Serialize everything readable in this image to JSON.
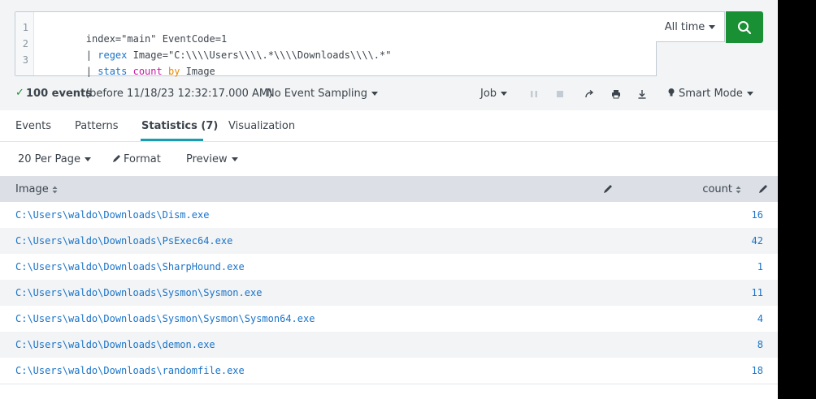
{
  "search": {
    "lines": [
      {
        "num": "1",
        "parts": [
          {
            "t": "index=\"main\" EventCode=1",
            "c": ""
          }
        ]
      },
      {
        "num": "2",
        "parts": [
          {
            "t": "| ",
            "c": ""
          },
          {
            "t": "regex",
            "c": "cmd"
          },
          {
            "t": " Image=\"C:\\\\\\\\Users\\\\\\\\.*\\\\\\\\Downloads\\\\\\\\.*\"",
            "c": ""
          }
        ]
      },
      {
        "num": "3",
        "parts": [
          {
            "t": "| ",
            "c": ""
          },
          {
            "t": "stats",
            "c": "cmd"
          },
          {
            "t": " ",
            "c": ""
          },
          {
            "t": "count",
            "c": "fn"
          },
          {
            "t": " ",
            "c": ""
          },
          {
            "t": "by",
            "c": "by"
          },
          {
            "t": " Image",
            "c": ""
          }
        ]
      }
    ],
    "time_range": "All time",
    "search_icon": "search-icon"
  },
  "status": {
    "check_icon": "✓",
    "events_count": "100 events",
    "events_before": "(before 11/18/23 12:32:17.000 AM)",
    "sampling": "No Event Sampling",
    "job": "Job",
    "mode": "Smart Mode"
  },
  "tabs": [
    {
      "label": "Events",
      "active": false
    },
    {
      "label": "Patterns",
      "active": false
    },
    {
      "label": "Statistics (7)",
      "active": true
    },
    {
      "label": "Visualization",
      "active": false
    }
  ],
  "toolbar": {
    "per_page": "20 Per Page",
    "format": "Format",
    "preview": "Preview"
  },
  "table": {
    "columns": [
      "Image",
      "count"
    ],
    "rows": [
      {
        "image": "C:\\Users\\waldo\\Downloads\\Dism.exe",
        "count": "16"
      },
      {
        "image": "C:\\Users\\waldo\\Downloads\\PsExec64.exe",
        "count": "42"
      },
      {
        "image": "C:\\Users\\waldo\\Downloads\\SharpHound.exe",
        "count": "1"
      },
      {
        "image": "C:\\Users\\waldo\\Downloads\\Sysmon\\Sysmon.exe",
        "count": "11"
      },
      {
        "image": "C:\\Users\\waldo\\Downloads\\Sysmon\\Sysmon\\Sysmon64.exe",
        "count": "4"
      },
      {
        "image": "C:\\Users\\waldo\\Downloads\\demon.exe",
        "count": "8"
      },
      {
        "image": "C:\\Users\\waldo\\Downloads\\randomfile.exe",
        "count": "18"
      }
    ]
  },
  "colors": {
    "accent": "#1a9cb0",
    "search_button": "#1a9035",
    "link": "#1a73c8"
  }
}
